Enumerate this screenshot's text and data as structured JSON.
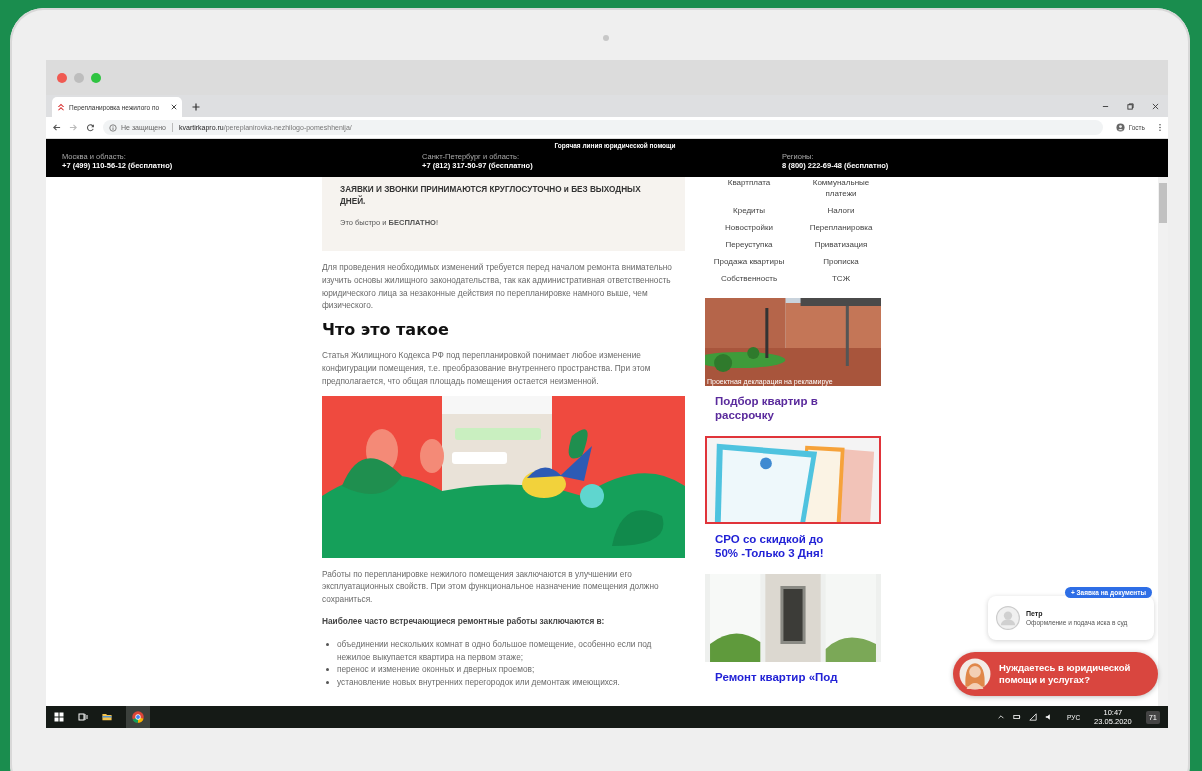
{
  "browser": {
    "tab_title": "Перепланировка нежилого по",
    "security": "Не защищено",
    "url_domain": "kvartirkapro.ru",
    "url_path": "/pereplanirovka-nezhilogo-pomeshhenija/",
    "profile": "Гость"
  },
  "hotline": {
    "title": "Горячая линия юридической помощи",
    "regions": [
      {
        "label": "Москва и область:",
        "phone": "+7 (499) 110-56-12 (бесплатно)"
      },
      {
        "label": "Санкт-Петербург и область:",
        "phone": "+7 (812) 317-50-97 (бесплатно)"
      },
      {
        "label": "Регионы:",
        "phone": "8 (800) 222-69-48 (бесплатно)"
      }
    ]
  },
  "notice": {
    "text": "ЗАЯВКИ И ЗВОНКИ ПРИНИМАЮТСЯ КРУГЛОСУТОЧНО и БЕЗ ВЫХОДНЫХ ДНЕЙ.",
    "note": "Это быстро и **БЕСПЛАТНО**!"
  },
  "article": {
    "intro": "Для проведения необходимых изменений требуется перед началом ремонта внимательно изучить основы жилищного законодательства, так как административная ответственность юридического лица за незаконные действия по перепланировке намного выше, чем физического.",
    "heading": "Что это такое",
    "paragraph": "Статья Жилищного Кодекса РФ под перепланировкой понимает любое изменение конфигурации помещения, т.е. преобразование внутреннего пространства. При этом предполагается, что общая площадь помещения остается неизменной.",
    "paragraph_2": "Работы по перепланировке нежилого помещения заключаются в улучшении его эксплуатационных свойств. При этом функциональное назначение помещения должно сохраниться.",
    "list_title": "Наиболее часто встречающиеся ремонтные работы заключаются в:",
    "list_items": [
      "объединении нескольких комнат в одно большое помещение, особенно если под нежилое выкупается квартира на первом этаже;",
      "перенос и изменение оконных и дверных проемов;",
      "установление новых внутренних перегородок или демонтаж имеющихся."
    ]
  },
  "categories": [
    "Квартплата",
    "Коммунальные платежи",
    "Кредиты",
    "Налоги",
    "Новостройки",
    "Перепланировка",
    "Переуступка",
    "Приватизация",
    "Продажа квартиры",
    "Прописка",
    "Собственность",
    "ТСЖ"
  ],
  "ads": [
    {
      "kind": "building",
      "caption": "Проектная декларация на рекламируе",
      "title": "Подбор квартир в рассрочку",
      "color": "#5a2a9c",
      "bordered": false
    },
    {
      "kind": "documents",
      "title": "СРО со скидкой до 50% -Только 3 Дня!",
      "color": "#2222d6",
      "bordered": true
    },
    {
      "kind": "interior",
      "title": "Ремонт квартир «Под",
      "color": "#2222d6",
      "bordered": false
    }
  ],
  "chat": {
    "badge": "+ Заявка на документы",
    "name": "Петр",
    "message": "Оформление и подача иска в суд",
    "prompt": "Нуждаетесь в юридической помощи и услугах?"
  },
  "taskbar": {
    "language": "РУС",
    "time": "10:47",
    "date": "23.05.2020",
    "notifications": "71"
  }
}
